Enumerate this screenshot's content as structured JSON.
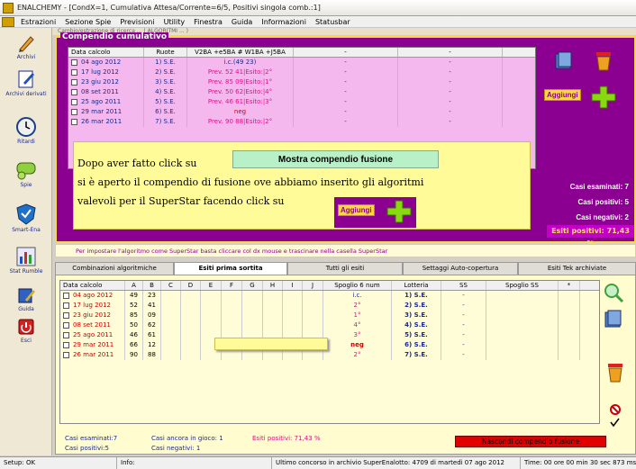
{
  "window": {
    "title": "ENALCHEMY - [CondX=1, Cumulativa Attesa/Corrente=6/5, Positivi singola comb.:1]"
  },
  "menu": [
    "Estrazioni",
    "Sezione Spie",
    "Previsioni",
    "Utility",
    "Finestra",
    "Guida",
    "Informazioni",
    "Statusbar"
  ],
  "sidebar": [
    {
      "label": "Archivi",
      "icon": "pencil-icon"
    },
    {
      "label": "Archivi derivati",
      "icon": "document-pencil-icon"
    },
    {
      "label": "Ritardi",
      "icon": "clock-icon"
    },
    {
      "label": "Spie",
      "icon": "binoculars-icon"
    },
    {
      "label": "Smart-Ena",
      "icon": "shield-check-icon"
    },
    {
      "label": "Stat Rumble",
      "icon": "chart-icon"
    },
    {
      "label": "Guida",
      "icon": "book-pencil-icon"
    },
    {
      "label": "Esci",
      "icon": "exit-icon"
    }
  ],
  "top_strip": "Cambio/estrazione di ricerca ... ( ALGORITMI ... )",
  "compendio": {
    "title": "Compendio cumulativo",
    "headers": [
      "Data calcolo",
      "Ruote",
      "V2BA +e5BA # W1BA +J5BA",
      "-",
      "-"
    ],
    "rows": [
      {
        "date": "04 ago 2012",
        "ruote": "1) S.E.",
        "v": "i.c.(49 23)",
        "a": "-",
        "b": "-",
        "vc": "blue"
      },
      {
        "date": "17 lug 2012",
        "ruote": "2) S.E.",
        "v": "Prev. 52 41|Esito:|2°",
        "a": "-",
        "b": "-",
        "vc": "pink"
      },
      {
        "date": "23 giu 2012",
        "ruote": "3) S.E.",
        "v": "Prev. 85 09|Esito:|1°",
        "a": "-",
        "b": "-",
        "vc": "pink"
      },
      {
        "date": "08 set 2011",
        "ruote": "4) S.E.",
        "v": "Prev. 50 62|Esito:|4°",
        "a": "-",
        "b": "-",
        "vc": "pink"
      },
      {
        "date": "25 ago 2011",
        "ruote": "5) S.E.",
        "v": "Prev. 46 61|Esito:|3°",
        "a": "-",
        "b": "-",
        "vc": "pink"
      },
      {
        "date": "29 mar 2011",
        "ruote": "6) S.E.",
        "v": "neg",
        "a": "-",
        "b": "-",
        "vc": "red"
      },
      {
        "date": "26 mar 2011",
        "ruote": "7) S.E.",
        "v": "Prev. 90 88|Esito:|2°",
        "a": "-",
        "b": "-",
        "vc": "pink"
      }
    ],
    "aggiungi_label": "Aggiungi",
    "stats": {
      "esaminati": "Casi esaminati: 7",
      "positivi": "Casi positivi: 5",
      "negativi": "Casi negativi: 2",
      "esiti": "Esiti positivi: 71,43 %"
    }
  },
  "overlay": {
    "line1": "Dopo aver fatto click su",
    "mostra_label": "Mostra compendio fusione",
    "line2": "si è aperto il compendio di fusione ove abbiamo inserito gli algoritmi",
    "line3": "valevoli per il SuperStar facendo click su",
    "aggiungi_label": "Aggiungi"
  },
  "note": "Per impostare l'algoritmo come SuperStar basta cliccare col dx mouse e trascinare nella casella SuperStar",
  "tabs": [
    "Combinazioni algoritmiche",
    "Esiti prima sortita",
    "Tutti gli esiti",
    "Settaggi Auto-copertura",
    "Esiti Tek archiviate"
  ],
  "esiti_table": {
    "headers": [
      "Data calcolo",
      "A",
      "B",
      "C",
      "D",
      "E",
      "F",
      "G",
      "H",
      "I",
      "J",
      "Spoglio 6 num",
      "Lotteria",
      "SS",
      "Spoglio SS",
      "*"
    ],
    "rows": [
      {
        "date": "04 ago 2012",
        "a": "49",
        "b": "23",
        "spoglio": "i.c.",
        "sc": "blue",
        "lotteria": "1) S.E.",
        "ss": "-"
      },
      {
        "date": "17 lug 2012",
        "a": "52",
        "b": "41",
        "spoglio": "2°",
        "sc": "pink",
        "lotteria": "2) S.E.",
        "ss": "-"
      },
      {
        "date": "23 giu 2012",
        "a": "85",
        "b": "09",
        "spoglio": "1°",
        "sc": "pink",
        "lotteria": "3) S.E.",
        "ss": "-"
      },
      {
        "date": "08 set 2011",
        "a": "50",
        "b": "62",
        "spoglio": "4°",
        "sc": "pink",
        "lotteria": "4) S.E.",
        "ss": "-"
      },
      {
        "date": "25 ago 2011",
        "a": "46",
        "b": "61",
        "spoglio": "3°",
        "sc": "pink",
        "lotteria": "5) S.E.",
        "ss": "-"
      },
      {
        "date": "29 mar 2011",
        "a": "66",
        "b": "12",
        "spoglio": "neg",
        "sc": "red",
        "lotteria": "6) S.E.",
        "ss": "-"
      },
      {
        "date": "26 mar 2011",
        "a": "90",
        "b": "88",
        "spoglio": "2°",
        "sc": "pink",
        "lotteria": "7) S.E.",
        "ss": "-"
      }
    ]
  },
  "footer": {
    "esaminati": "Casi esaminati:7",
    "positivi": "Casi positivi:5",
    "ancora": "Casi ancora in gioco: 1",
    "negativi": "Casi negativi: 1",
    "esiti": "Esiti positivi: 71,43 %",
    "nascondi_label": "Nascondi compendio fusione"
  },
  "statusbar": {
    "setup": "Setup: OK",
    "info": "Info:",
    "ultimo": "Ultimo concorso in archivio SuperEnalotto: 4709 di martedì 07 ago 2012",
    "time": "Time: 00 ore 00 min 30 sec 873 ms"
  }
}
